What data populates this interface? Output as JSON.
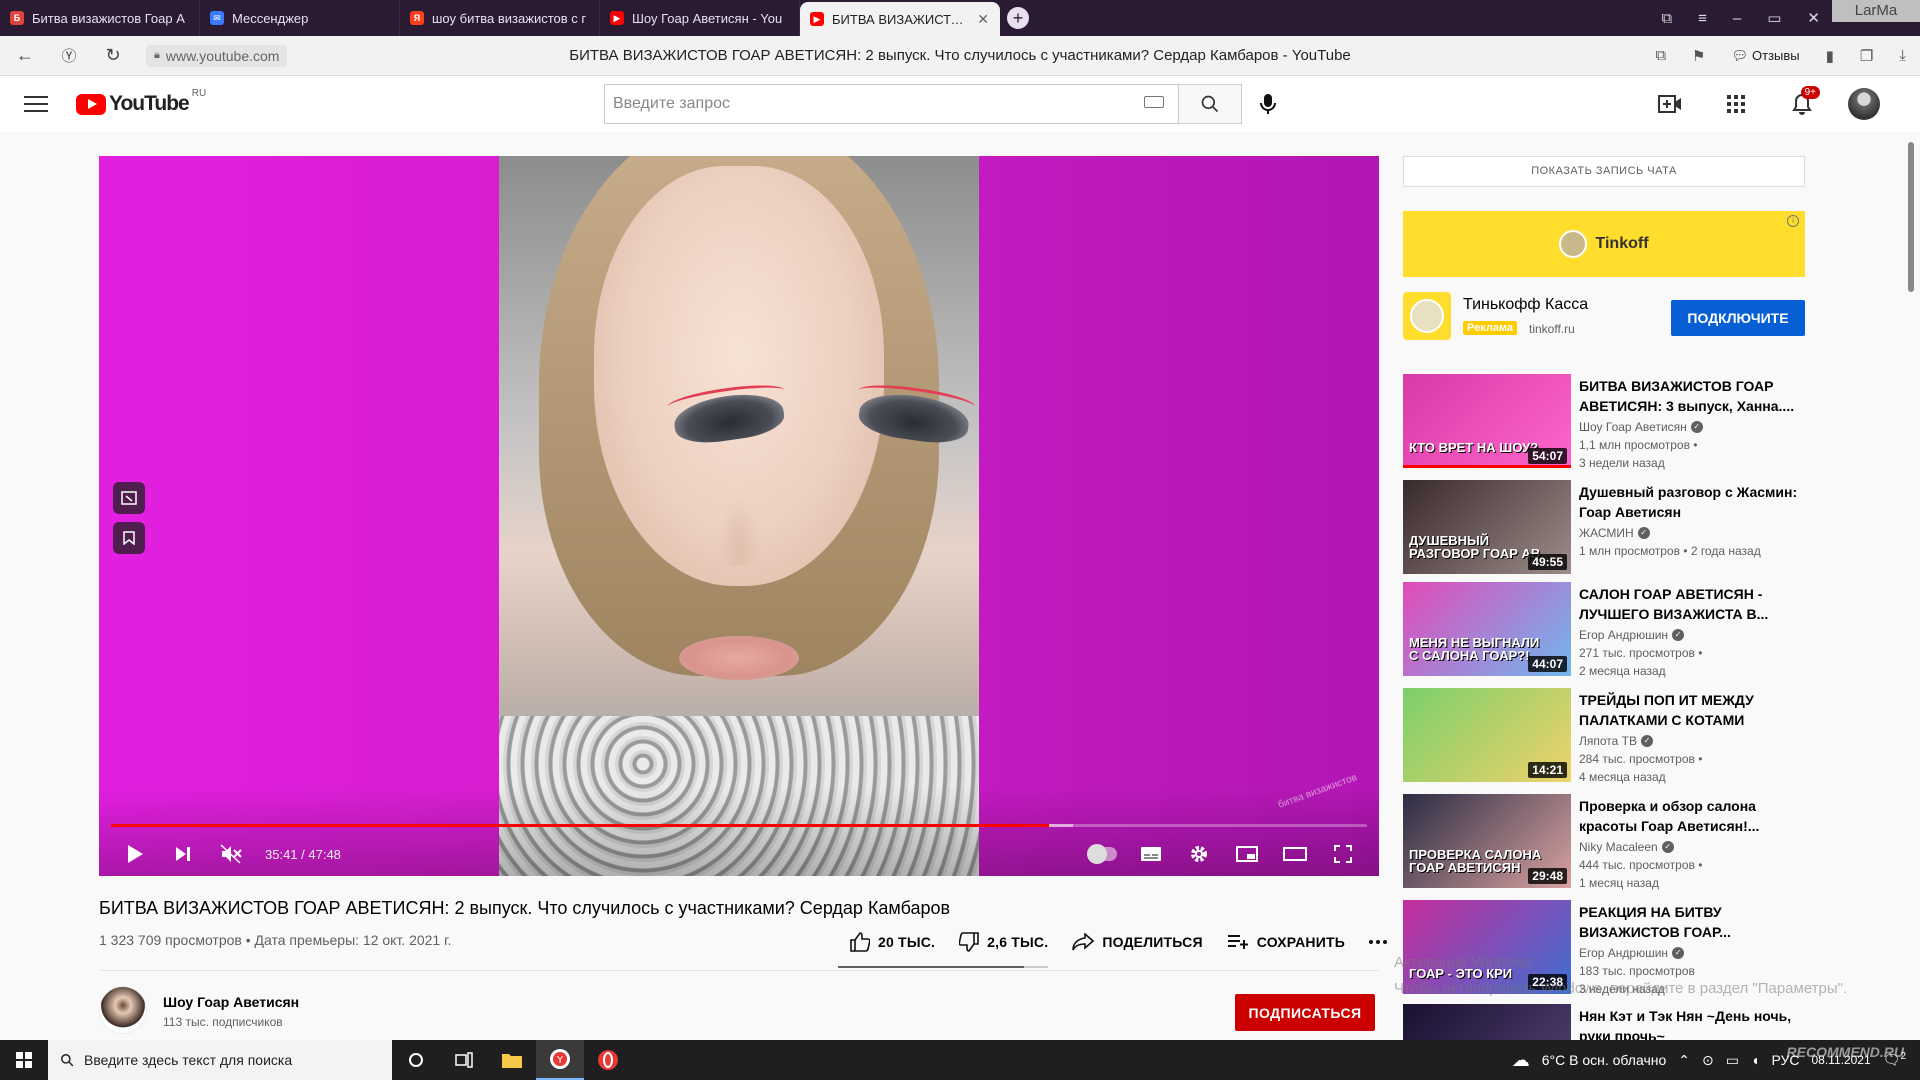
{
  "browser": {
    "tabs": [
      {
        "title": "Битва визажистов Гоар А",
        "fav_color": "#e0423c",
        "fav_glyph": "Б"
      },
      {
        "title": "Мессенджер",
        "fav_color": "#3a7bfd",
        "fav_glyph": "✉"
      },
      {
        "title": "шоу битва визажистов с г",
        "fav_color": "#fc3f1d",
        "fav_glyph": "Я"
      },
      {
        "title": "Шоу Гоар Аветисян - You",
        "fav_color": "#ff0000",
        "fav_glyph": "▶"
      },
      {
        "title": "БИТВА ВИЗАЖИСТОВ Г",
        "fav_color": "#ff0000",
        "fav_glyph": "▶",
        "active": true
      }
    ],
    "active_tab_close": "✕",
    "new_tab": "+",
    "corner_label": "LarMa",
    "url": "www.youtube.com",
    "page_title": "БИТВА ВИЗАЖИСТОВ ГОАР АВЕТИСЯН: 2 выпуск. Что случилось с участниками? Сердар Камбаров - YouTube",
    "feedback_label": "Отзывы"
  },
  "youtube": {
    "logo_text": "YouTube",
    "region": "RU",
    "search_placeholder": "Введите запрос",
    "notifications_badge": "9+"
  },
  "player": {
    "time_current": "35:41",
    "time_total": "47:48",
    "time_display": "35:41 / 47:48",
    "played_fraction": 0.7466,
    "loaded_fraction": 0.766,
    "watermark": "битва визажистов",
    "colors": {
      "background": "#d61ecf",
      "progress": "#ff0000"
    }
  },
  "video": {
    "title": "БИТВА ВИЗАЖИСТОВ ГОАР АВЕТИСЯН: 2 выпуск. Что случилось с участниками? Сердар Камбаров",
    "meta": "1 323 709 просмотров • Дата премьеры: 12 окт. 2021 г.",
    "likes": "20 ТЫС.",
    "dislikes": "2,6 ТЫС.",
    "share_label": "ПОДЕЛИТЬСЯ",
    "save_label": "СОХРАНИТЬ",
    "like_ratio": 0.885,
    "channel": {
      "name": "Шоу Гоар Аветисян",
      "subscribers": "113 тыс. подписчиков",
      "subscribe_label": "ПОДПИСАТЬСЯ"
    }
  },
  "sidebar": {
    "chat_replay_label": "ПОКАЗАТЬ ЗАПИСЬ ЧАТА",
    "ad": {
      "banner_brand": "Tinkoff",
      "title": "Тинькофф Касса",
      "tag": "Реклама",
      "domain": "tinkoff.ru",
      "cta": "ПОДКЛЮЧИТЕ",
      "info": "i"
    },
    "recommendations": [
      {
        "title": "БИТВА ВИЗАЖИСТОВ ГОАР АВЕТИСЯН: 3 выпуск, Ханна....",
        "channel": "Шоу Гоар Аветисян",
        "views": "1,1 млн просмотров •",
        "age": "3 недели назад",
        "duration": "54:07",
        "caption": "КТО ВРЕТ НА ШОУ?",
        "colors": [
          "#d93aa6",
          "#ff66cc"
        ],
        "watched": 1.0
      },
      {
        "title": "Душевный разговор с Жасмин: Гоар Аветисян",
        "channel": "ЖАСМИН",
        "views": "1 млн просмотров • 2 года назад",
        "age": "",
        "duration": "49:55",
        "caption": "ДУШЕВНЫЙ РАЗГОВОР ГОАР АВ",
        "colors": [
          "#3a2b2b",
          "#9c8c8a"
        ],
        "watched": 0
      },
      {
        "title": "САЛОН ГОАР АВЕТИСЯН - ЛУЧШЕГО ВИЗАЖИСТА В...",
        "channel": "Егор Андрюшин",
        "views": "271 тыс. просмотров •",
        "age": "2 месяца назад",
        "duration": "44:07",
        "caption": "МЕНЯ НЕ ВЫГНАЛИ С САЛОНА ГОАР?!",
        "colors": [
          "#e24ab8",
          "#6fb8ef"
        ],
        "watched": 0
      },
      {
        "title": "ТРЕЙДЫ ПОП ИТ МЕЖДУ ПАЛАТКАМИ С КОТАМИ",
        "channel": "Ляпота ТВ",
        "views": "284 тыс. просмотров •",
        "age": "4 месяца назад",
        "duration": "14:21",
        "caption": "",
        "colors": [
          "#7bcf6a",
          "#f0d26b"
        ],
        "watched": 0
      },
      {
        "title": "Проверка и обзор салона красоты Гоар Аветисян!...",
        "channel": "Niky Macaleen",
        "views": "444 тыс. просмотров •",
        "age": "1 месяц назад",
        "duration": "29:48",
        "caption": "ПРОВЕРКА САЛОНА ГОАР АВЕТИСЯН",
        "colors": [
          "#2c2c44",
          "#d9a3a0"
        ],
        "watched": 0
      },
      {
        "title": "РЕАКЦИЯ НА БИТВУ ВИЗАЖИСТОВ ГОАР...",
        "channel": "Егор Андрюшин",
        "views": "183 тыс. просмотров",
        "age": "3 недели назад",
        "duration": "22:38",
        "caption": "ГОАР - ЭТО КРИ",
        "colors": [
          "#c62c9c",
          "#3d6fd0"
        ],
        "watched": 0
      },
      {
        "title": "Нян Кэт и Тэк Нян ~День ночь, руки прочь~",
        "channel": "",
        "views": "",
        "age": "",
        "duration": "",
        "caption": "",
        "colors": [
          "#1a1030",
          "#554477"
        ],
        "watched": 0
      }
    ],
    "activation_line1": "Активация Windows",
    "activation_line2": "Чтобы активировать Windows, перейдите в раздел \"Параметры\"."
  },
  "taskbar": {
    "search_placeholder": "Введите здесь текст для поиска",
    "weather": "6°C  В осн. облачно",
    "lang": "РУС",
    "date": "08.11.2021",
    "notification_count": "2",
    "watermark": "RECOMMEND.RU"
  }
}
